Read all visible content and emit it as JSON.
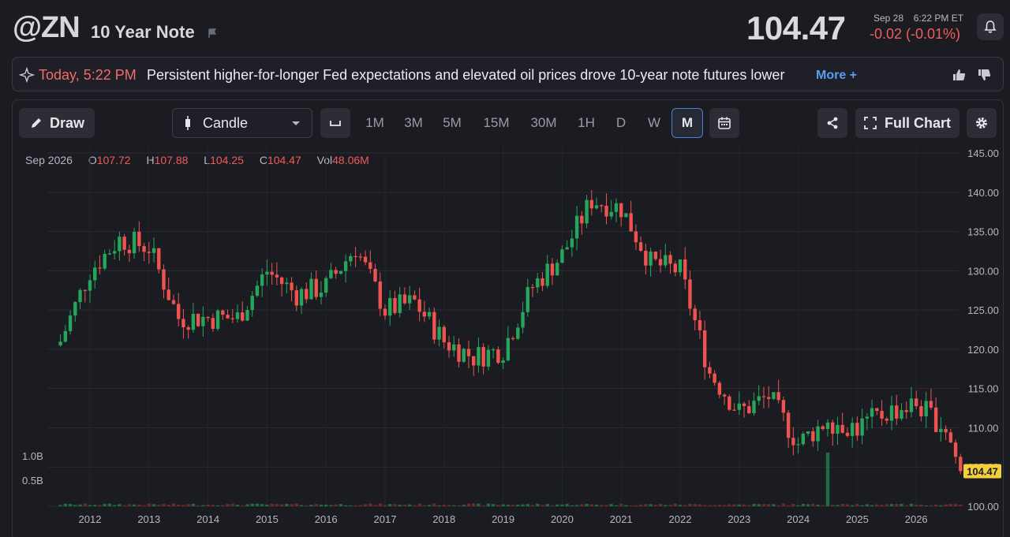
{
  "header": {
    "symbol": "@ZN",
    "name": "10 Year Note",
    "price": "104.47",
    "date": "Sep 28",
    "time": "6:22 PM ET",
    "change": "-0.02 (-0.01%)"
  },
  "news": {
    "time": "Today, 5:22 PM",
    "headline": "Persistent higher-for-longer Fed expectations and elevated oil prices drove 10-year note futures lower",
    "more_label": "More +"
  },
  "toolbar": {
    "draw_label": "Draw",
    "chart_type": "Candle",
    "timeframes": [
      "1M",
      "3M",
      "5M",
      "15M",
      "30M",
      "1H",
      "D",
      "W",
      "M"
    ],
    "active_timeframe": "M",
    "full_chart_label": "Full Chart"
  },
  "ohlc": {
    "period": "Sep 2026",
    "o_label": "O",
    "o": "107.72",
    "h_label": "H",
    "h": "107.88",
    "l_label": "L",
    "l": "104.25",
    "c_label": "C",
    "c": "104.47",
    "vol_label": "Vol",
    "vol": "48.06M"
  },
  "colors": {
    "up": "#26a65b",
    "down": "#ef5350",
    "accent": "#5b9cf2",
    "price_tag": "#f3cf3c"
  },
  "chart_data": {
    "type": "candlestick",
    "y_axis_ticks": [
      "145.00",
      "140.00",
      "135.00",
      "130.00",
      "125.00",
      "120.00",
      "115.00",
      "110.00",
      "105.00",
      "100.00"
    ],
    "x_axis_ticks": [
      "2012",
      "2013",
      "2014",
      "2015",
      "2016",
      "2017",
      "2018",
      "2019",
      "2020",
      "2021",
      "2022",
      "2023",
      "2024",
      "2025",
      "2026"
    ],
    "volume_ticks": [
      "1.0B",
      "0.5B"
    ],
    "ylim": [
      100,
      145
    ],
    "last_price_label": "104.47",
    "x": [
      2011.5,
      2012.0,
      2012.5,
      2013.0,
      2013.5,
      2014.0,
      2014.5,
      2015.0,
      2015.5,
      2016.0,
      2016.5,
      2017.0,
      2017.5,
      2018.0,
      2018.5,
      2019.0,
      2019.5,
      2020.0,
      2020.5,
      2021.0,
      2021.5,
      2022.0,
      2022.5,
      2023.0,
      2023.5,
      2024.0,
      2024.5,
      2025.0,
      2025.5,
      2026.0,
      2026.5,
      2026.75
    ],
    "close": [
      121,
      130,
      134,
      133,
      124,
      124,
      124,
      130,
      127,
      128,
      133,
      125,
      126,
      121,
      119,
      120,
      128,
      132,
      139,
      138,
      131,
      130,
      117,
      112,
      114,
      108,
      111,
      110,
      112,
      113,
      110,
      104.47
    ]
  }
}
